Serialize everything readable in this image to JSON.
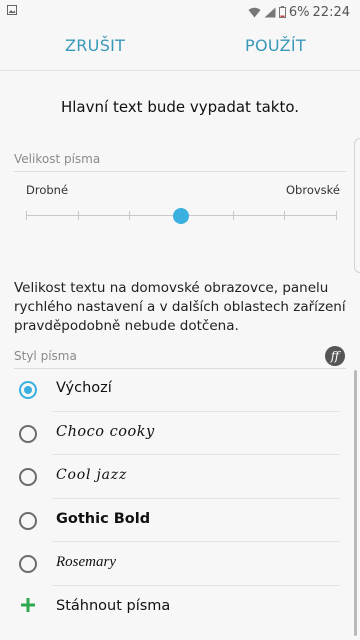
{
  "status_bar": {
    "battery_percent": "6%",
    "time": "22:24"
  },
  "action_bar": {
    "cancel_label": "ZRUŠIT",
    "apply_label": "POUŽÍT"
  },
  "preview_text": "Hlavní text bude vypadat takto.",
  "font_size": {
    "header": "Velikost písma",
    "min_label": "Drobné",
    "max_label": "Obrovské",
    "steps": 7,
    "selected_step": 3
  },
  "info_text": "Velikost textu na domovské obrazovce, panelu rychlého nastavení a v dalších oblastech zařízení pravděpodobně nebude dotčena.",
  "font_style": {
    "header": "Styl písma",
    "items": [
      {
        "label": "Výchozí",
        "selected": true
      },
      {
        "label": "Choco cooky",
        "selected": false
      },
      {
        "label": "Cool jazz",
        "selected": false
      },
      {
        "label": "Gothic Bold",
        "selected": false
      },
      {
        "label": "Rosemary",
        "selected": false
      }
    ],
    "download_label": "Stáhnout písma"
  },
  "colors": {
    "accent": "#3ab0e0",
    "action_text": "#3a98b8",
    "download_plus": "#2fa84f"
  }
}
